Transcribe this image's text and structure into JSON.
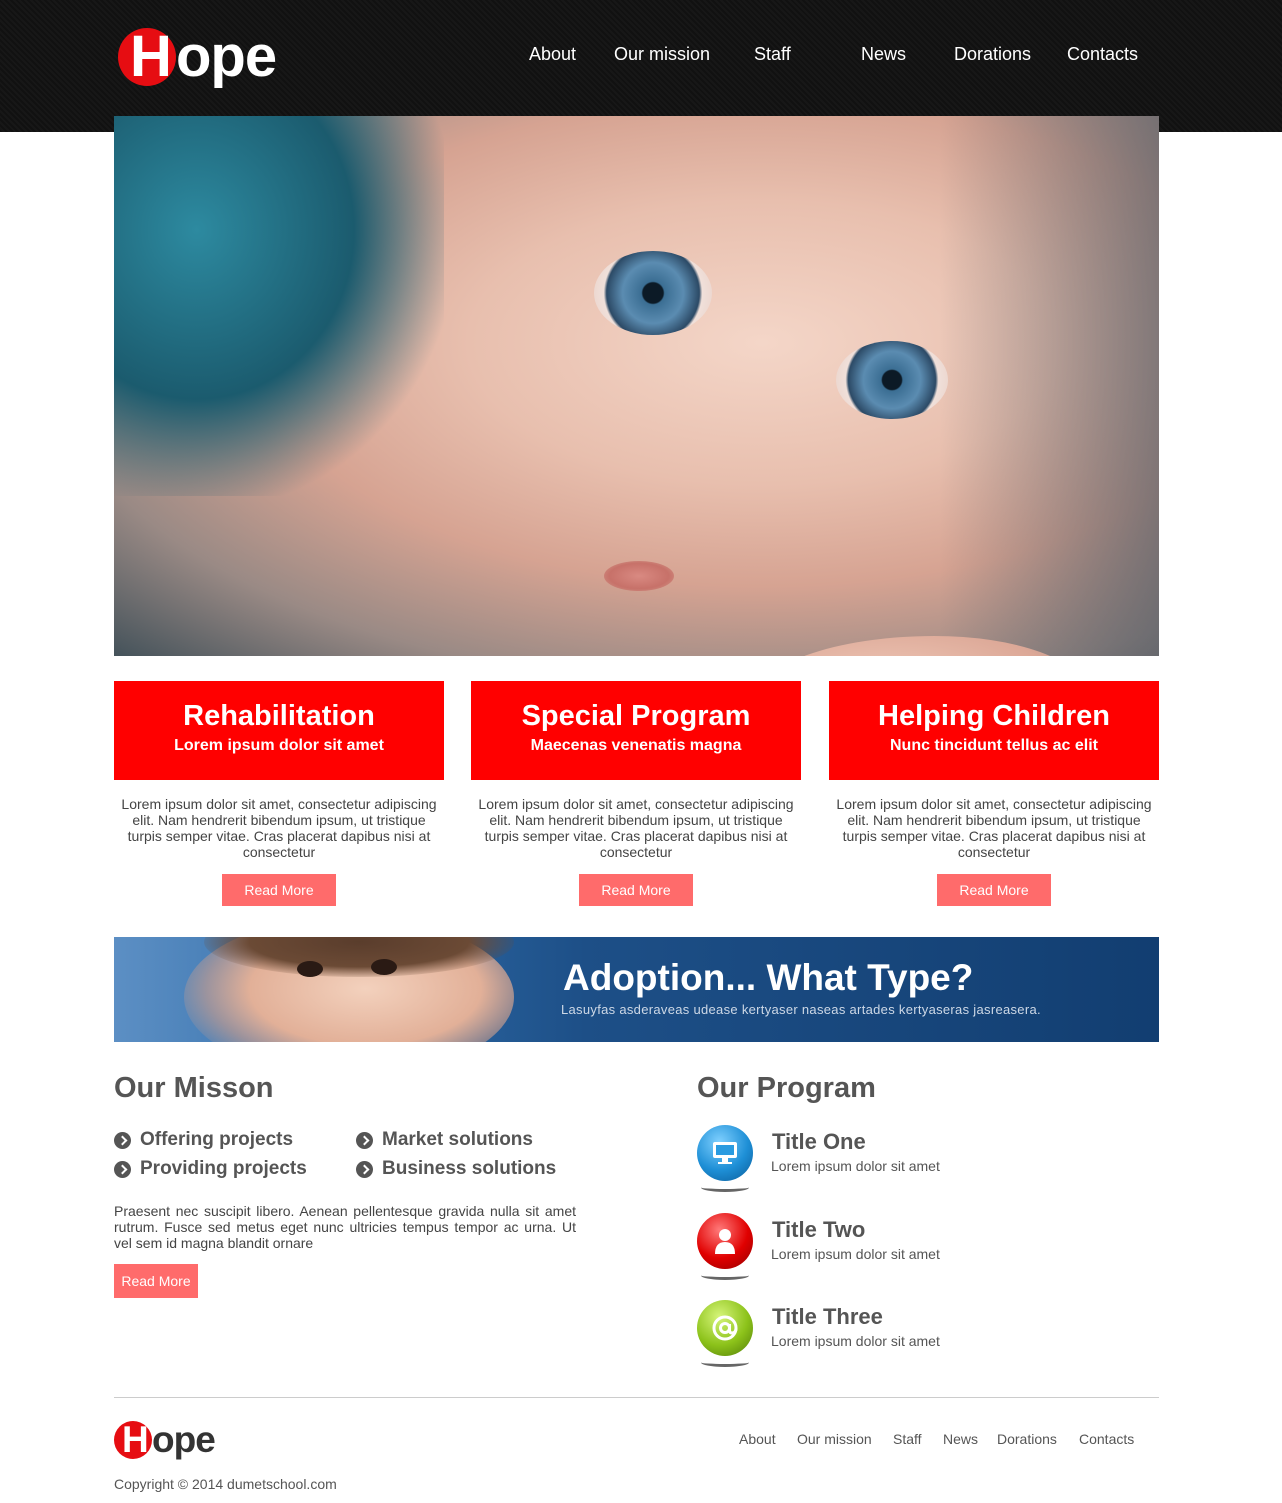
{
  "header": {
    "logo": {
      "first": "H",
      "rest": "ope"
    },
    "nav": [
      "About",
      "Our mission",
      "Staff",
      "News",
      "Dorations",
      "Contacts"
    ]
  },
  "features": [
    {
      "title": "Rehabilitation",
      "subtitle": "Lorem ipsum dolor sit amet",
      "text": "Lorem ipsum dolor sit amet, consectetur adipiscing elit. Nam hendrerit bibendum ipsum, ut tristique turpis semper vitae. Cras placerat dapibus nisi at consectetur",
      "button": "Read More"
    },
    {
      "title": "Special Program",
      "subtitle": "Maecenas venenatis magna",
      "text": "Lorem ipsum dolor sit amet, consectetur adipiscing elit. Nam hendrerit bibendum ipsum, ut tristique turpis semper vitae. Cras placerat dapibus nisi at consectetur",
      "button": "Read More"
    },
    {
      "title": "Helping Children",
      "subtitle": "Nunc tincidunt tellus ac elit",
      "text": "Lorem ipsum dolor sit amet, consectetur adipiscing elit. Nam hendrerit bibendum ipsum, ut tristique turpis semper vitae. Cras placerat dapibus nisi at consectetur",
      "button": "Read More"
    }
  ],
  "banner": {
    "title": "Adoption... What Type?",
    "subtitle": "Lasuyfas asderaveas udease kertyaser naseas artades kertyaseras jasreasera."
  },
  "mission": {
    "title": "Our Misson",
    "bullets": [
      "Offering projects",
      "Providing projects",
      "Market solutions",
      "Business solutions"
    ],
    "text": "Praesent nec suscipit libero. Aenean pellentesque gravida nulla sit amet rutrum. Fusce sed metus eget nunc ultricies tempus tempor ac urna. Ut vel sem id magna blandit ornare",
    "button": "Read More"
  },
  "program": {
    "title": "Our Program",
    "items": [
      {
        "title": "Title One",
        "text": "Lorem ipsum dolor sit amet",
        "icon": "monitor-icon",
        "color": "#1e8fd6"
      },
      {
        "title": "Title Two",
        "text": "Lorem ipsum dolor sit amet",
        "icon": "user-icon",
        "color": "#e00000"
      },
      {
        "title": "Title Three",
        "text": "Lorem ipsum dolor sit amet",
        "icon": "at-sign-icon",
        "color": "#8cc21a"
      }
    ]
  },
  "footer": {
    "logo": {
      "first": "H",
      "rest": "ope"
    },
    "nav": [
      "About",
      "Our mission",
      "Staff",
      "News",
      "Dorations",
      "Contacts"
    ],
    "copyright": "Copyright © 2014 dumetschool.com"
  },
  "colors": {
    "brand_red": "#ff0000",
    "button": "#ff6b6b",
    "header_bg": "#111111",
    "text": "#555555"
  }
}
